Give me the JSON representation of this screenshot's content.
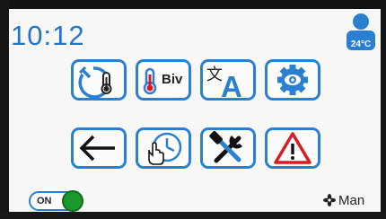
{
  "status": {
    "time": "10:12",
    "outdoor_temp": "24°C"
  },
  "menu": [
    {
      "name": "temperature-timer",
      "label": ""
    },
    {
      "name": "bivalence",
      "label": "Biv"
    },
    {
      "name": "language",
      "label": ""
    },
    {
      "name": "view",
      "label": ""
    },
    {
      "name": "back",
      "label": ""
    },
    {
      "name": "schedule",
      "label": ""
    },
    {
      "name": "service-tools",
      "label": ""
    },
    {
      "name": "alarms",
      "label": ""
    }
  ],
  "power_switch": {
    "label": "ON",
    "state": "on"
  },
  "mode": {
    "icon": "fan-icon",
    "label": "Man"
  },
  "colors": {
    "accent": "#2a7fd3",
    "time_text": "#1f74c8",
    "switch_on": "#1a9a2c",
    "alarm": "#d71d22"
  }
}
